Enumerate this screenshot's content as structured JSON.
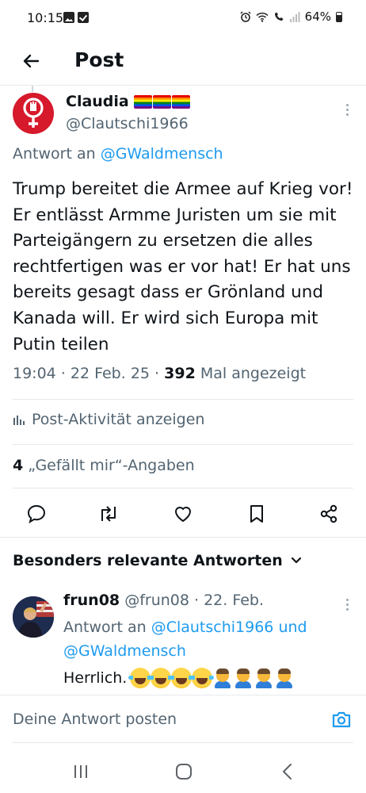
{
  "status_bar": {
    "time": "10:15",
    "battery": "64%",
    "battery_level": 0.64,
    "icons": [
      "gallery-icon",
      "checkbox-icon",
      "alarm-icon",
      "wifi-icon",
      "wifi-call-icon",
      "signal-icon",
      "battery-icon"
    ]
  },
  "header": {
    "title": "Post",
    "back_icon": "back-arrow-icon"
  },
  "post": {
    "author_name": "Claudia",
    "author_flags": [
      "rainbow-flag",
      "rainbow-flag",
      "rainbow-flag"
    ],
    "author_handle": "@Clautschi1966",
    "reply_to_label": "Antwort an",
    "reply_to_mention": "@GWaldmensch",
    "text": "Trump bereitet die Armee auf Krieg vor! Er entlässt Armme Juristen um sie mit Parteigängern zu ersetzen die alles rechtfertigen was er vor hat! Er hat uns bereits gesagt dass er Grönland und Kanada will. Er wird sich Europa mit Putin teilen",
    "time": "19:04",
    "date": "22 Feb. 25",
    "views_count": "392",
    "views_label": "Mal angezeigt",
    "activity_label": "Post-Aktivität anzeigen",
    "likes_count": "4",
    "likes_label": "„Gefällt mir“-Angaben"
  },
  "actions": [
    "reply-icon",
    "repost-icon",
    "like-icon",
    "bookmark-icon",
    "share-icon"
  ],
  "replies_section": {
    "title": "Besonders relevante Antworten"
  },
  "reply": {
    "author_name": "frun08",
    "author_handle": "@frun08",
    "date": "22. Feb.",
    "reply_to_label": "Antwort an",
    "reply_to_mention_1": "@Clautschi1966",
    "reply_to_and": "und",
    "reply_to_mention_2": "@GWaldmensch",
    "text": "Herrlich.",
    "emojis": [
      "laughing-crying-emoji",
      "laughing-crying-emoji",
      "laughing-crying-emoji",
      "laughing-crying-emoji",
      "facepalm-emoji",
      "facepalm-emoji",
      "facepalm-emoji",
      "facepalm-emoji"
    ]
  },
  "compose": {
    "placeholder": "Deine Antwort posten",
    "camera_icon": "camera-icon"
  },
  "nav": [
    "recents-icon",
    "home-icon",
    "back-icon"
  ],
  "colors": {
    "accent": "#1d9bf0",
    "text_primary": "#0f1419",
    "text_secondary": "#536471",
    "avatar_red": "#d6192b"
  }
}
